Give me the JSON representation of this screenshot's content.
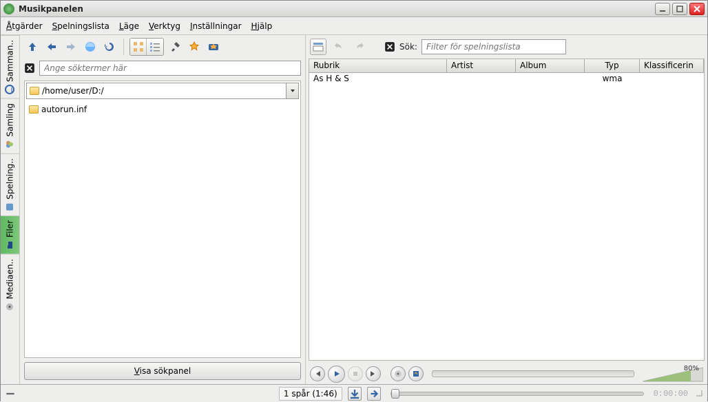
{
  "window": {
    "title": "Musikpanelen"
  },
  "menus": {
    "actions": {
      "label": "Åtgärder",
      "accel_idx": 0
    },
    "playlist": {
      "label": "Spelningslista",
      "accel_idx": 0
    },
    "mode": {
      "label": "Läge",
      "accel_idx": 0
    },
    "tools": {
      "label": "Verktyg",
      "accel_idx": 0
    },
    "settings": {
      "label": "Inställningar",
      "accel_idx": 0
    },
    "help": {
      "label": "Hjälp",
      "accel_idx": 0
    }
  },
  "sidetabs": {
    "samman": {
      "label": "Samman.."
    },
    "samling": {
      "label": "Samling"
    },
    "spelning": {
      "label": "Spelning.."
    },
    "filer": {
      "label": "Filer"
    },
    "mediaen": {
      "label": "Mediaen.."
    }
  },
  "left": {
    "search_placeholder": "Ange söktermer här",
    "path": "/home/user/D:/",
    "tree": {
      "items": [
        {
          "name": "autorun.inf"
        }
      ]
    },
    "show_search_label": "Visa sökpanel"
  },
  "right": {
    "search_label": "Sök:",
    "search_placeholder": "Filter för spelningslista",
    "columns": {
      "rubrik": "Rubrik",
      "artist": "Artist",
      "album": "Album",
      "typ": "Typ",
      "klass": "Klassificerin"
    },
    "rows": [
      {
        "rubrik": "As H & S",
        "artist": "",
        "album": "",
        "typ": "wma",
        "klass": ""
      }
    ]
  },
  "transport": {
    "volume_label": "80%"
  },
  "status": {
    "track_info": "1 spår (1:46)",
    "time": "0:00:00"
  }
}
